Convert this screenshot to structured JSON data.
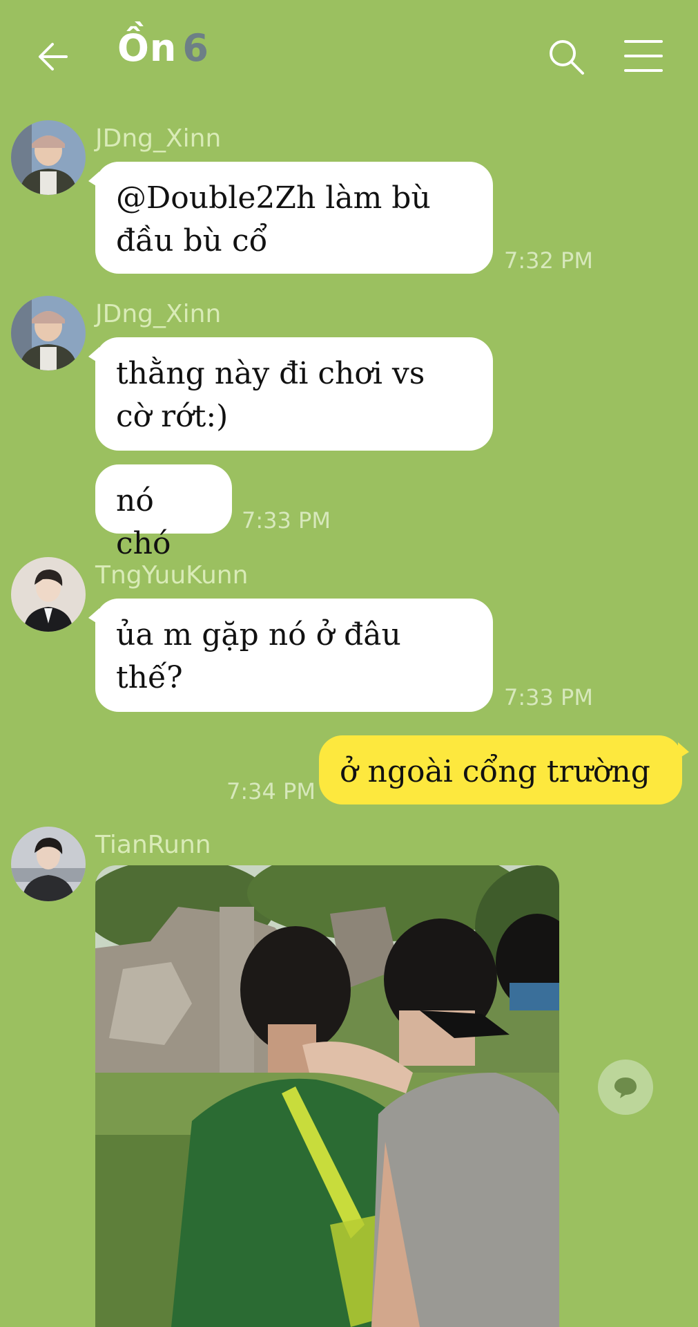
{
  "header": {
    "title": "Ồn",
    "member_count": "6"
  },
  "messages": [
    {
      "username": "JDng_Xinn",
      "lines": [
        "@Double2Zh làm bù",
        "đầu bù cổ"
      ],
      "time": "7:32 PM"
    },
    {
      "username": "JDng_Xinn",
      "lines": [
        "thằng này đi chơi vs",
        "cờ rớt:)"
      ]
    },
    {
      "lines": [
        "nó chó"
      ],
      "time": "7:33 PM"
    },
    {
      "username": "TngYuuKunn",
      "lines": [
        "ủa m gặp nó ở đâu",
        "thế?"
      ],
      "time": "7:33 PM"
    },
    {
      "lines": [
        "ở ngoài cổng trường"
      ],
      "time": "7:34 PM",
      "mine": true
    },
    {
      "username": "TianRunn",
      "image": "photo of people at a zoo enclosure"
    }
  ],
  "colors": {
    "background": "#9bc060",
    "bubble_other": "#ffffff",
    "bubble_mine": "#fde83e"
  },
  "icons": [
    "back-arrow-icon",
    "search-icon",
    "menu-icon",
    "chat-bubble-icon"
  ]
}
